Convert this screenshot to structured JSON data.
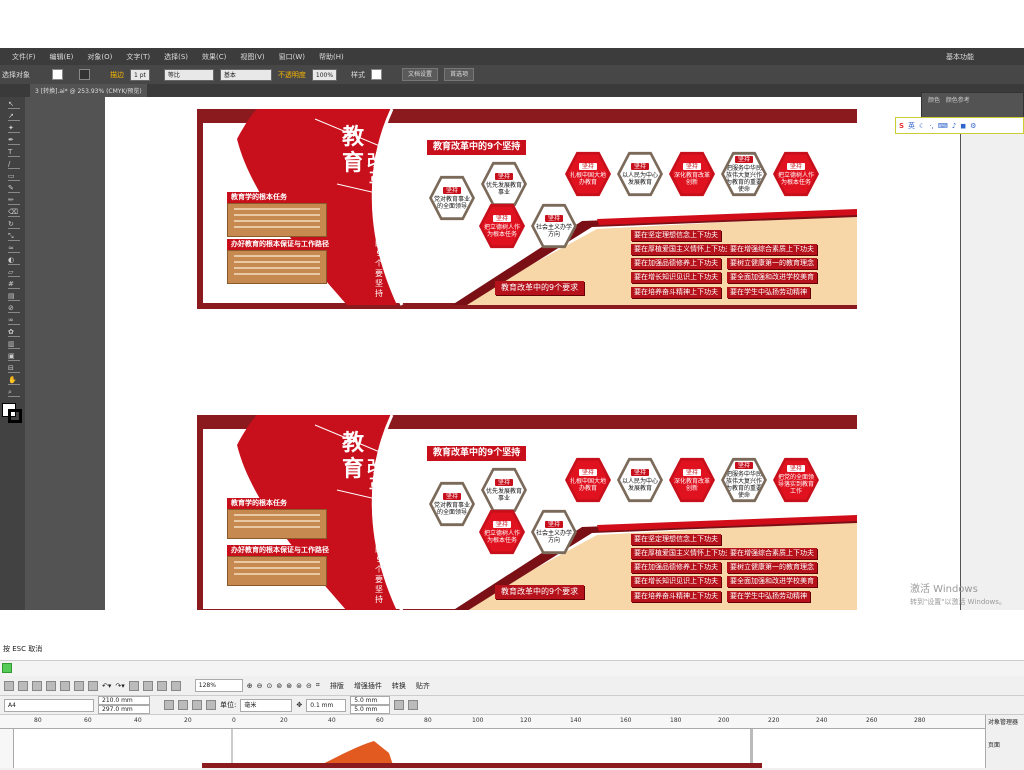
{
  "menu": [
    "文件(F)",
    "编辑(E)",
    "对象(O)",
    "文字(T)",
    "选择(S)",
    "效果(C)",
    "视图(V)",
    "窗口(W)",
    "帮助(H)"
  ],
  "workspace": "基本功能",
  "control": {
    "selection_label": "选择对象",
    "stroke_label": "描边",
    "stroke_value": "1 pt",
    "uniform_label": "等比",
    "basic_label": "基本",
    "opacity_label": "不透明度",
    "opacity_value": "100%",
    "style_label": "样式",
    "doc_setup": "文档设置",
    "prefs": "首选项"
  },
  "doc_tab": "3 [转换].ai* @ 253.93% (CMYK/预览)",
  "color_panel": {
    "tab1": "颜色",
    "tab2": "颜色参考"
  },
  "ime_label": "英",
  "design": {
    "big_title_1": "教",
    "big_title_2": "育",
    "big_title_3": "改",
    "big_title_4": "革",
    "vertical_text": "教育改革中的9个要坚持",
    "box1_title": "教育学的根本任务",
    "box2_title": "办好教育的根本保证与工作路径",
    "nine_persist_title": "教育改革中的9个坚持",
    "nine_require_title": "教育改革中的9个要求",
    "tag": "坚持",
    "hexes_top": [
      "扎根中国大地办教育",
      "以人民为中心发展教育",
      "深化教育改革创新",
      "把服务中华民族伟大复兴作为教育的重要使命",
      "把立德树人作为根本任务"
    ],
    "hexes_top_alt": [
      "扎根中国大地办教育",
      "以人民为中心发展教育",
      "深化教育改革创新",
      "把服务中华民族伟大复兴作为教育的重要使命",
      "把党的全面领导落实到教育工作"
    ],
    "hexes_left": [
      "党对教育事业的全面领导",
      "优先发展教育事业",
      "把立德树人作为根本任务",
      "社会主义办学方向"
    ],
    "requirements_left": [
      "要在坚定理想信念上下功夫",
      "要在厚植爱国主义情怀上下功夫",
      "要在加强品德修养上下功夫",
      "要在增长知识见识上下功夫",
      "要在培养奋斗精神上下功夫"
    ],
    "requirements_right": [
      "要在增强综合素质上下功夫",
      "要树立健康第一的教育理念",
      "要全面加强和改进学校美育",
      "要在学生中弘扬劳动精神"
    ]
  },
  "activation": {
    "line1": "激活 Windows",
    "line2": "转到\"设置\"以激活 Windows。"
  },
  "lower": {
    "esc_hint": "按 ESC 取消",
    "zoom": "128%",
    "toolbar": [
      "排版",
      "增强插件",
      "转换",
      "贴齐"
    ],
    "page_size": "A4",
    "width": "210.0 mm",
    "height": "297.0 mm",
    "unit_label": "单位:",
    "unit": "毫米",
    "nudge": "0.1 mm",
    "dup_x": "5.0 mm",
    "dup_y": "5.0 mm",
    "ruler_ticks": [
      "80",
      "60",
      "40",
      "20",
      "0",
      "20",
      "40",
      "60",
      "80",
      "100",
      "120",
      "140",
      "160",
      "180",
      "200",
      "220",
      "240",
      "260",
      "280"
    ],
    "obj_manager": "对象管理器",
    "page_label": "页面"
  }
}
